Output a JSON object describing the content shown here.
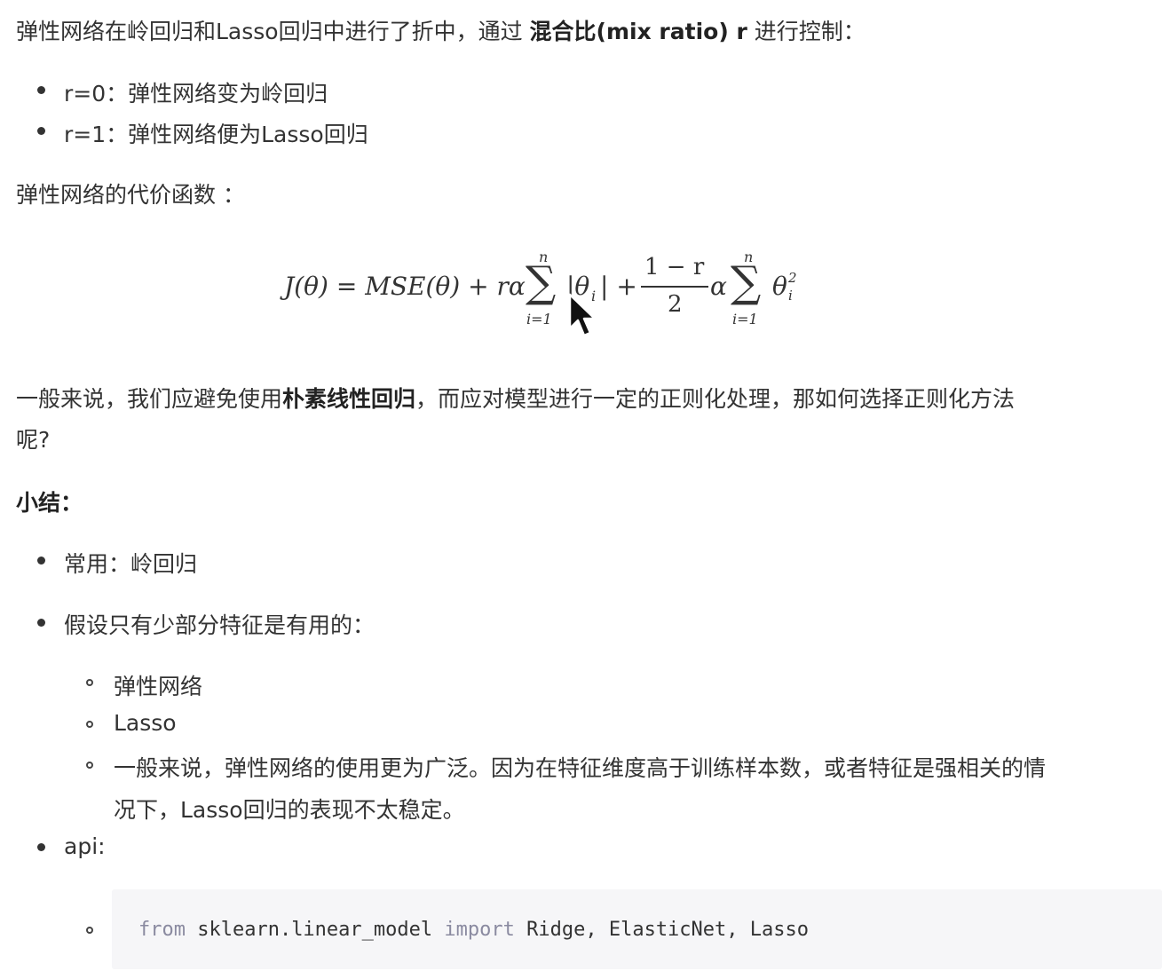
{
  "intro": {
    "prefix": "弹性网络在岭回归和Lasso回归中进行了折中，通过 ",
    "bold": "混合比(mix ratio) r",
    "suffix": " 进行控制："
  },
  "mix_list": [
    "r=0：弹性网络变为岭回归",
    "r=1：弹性网络便为Lasso回归"
  ],
  "cost_heading": "弹性网络的代价函数 ：",
  "formula": {
    "lhs": "J(θ) = MSE(θ) + rα",
    "sum_top": "n",
    "sum_bottom": "i=1",
    "abs_term": "|θ",
    "abs_sub": "i",
    "abs_end": "| +",
    "frac_num": "1 − r",
    "frac_den": "2",
    "alpha": "α",
    "theta": "θ",
    "theta_sub": "i",
    "theta_sup": "2"
  },
  "advice": {
    "prefix": "一般来说，我们应避免使用",
    "bold": "朴素线性回归",
    "suffix": "，而应对模型进行一定的正则化处理，那如何选择正则化方法",
    "line2": "呢?"
  },
  "summary_heading": "小结：",
  "summary": {
    "common": "常用：岭回归",
    "few_features": "假设只有少部分特征是有用的：",
    "sub_items": [
      "弹性网络",
      "Lasso",
      "一般来说，弹性网络的使用更为广泛。因为在特征维度高于训练样本数，或者特征是强相关的情",
      "况下，Lasso回归的表现不太稳定。"
    ],
    "api": "api:"
  },
  "code": {
    "kw_from": "from",
    "module": " sklearn.linear_model ",
    "kw_import": "import",
    "names": " Ridge, ElasticNet, Lasso"
  },
  "icons": {
    "cursor": "mouse-pointer-icon"
  }
}
